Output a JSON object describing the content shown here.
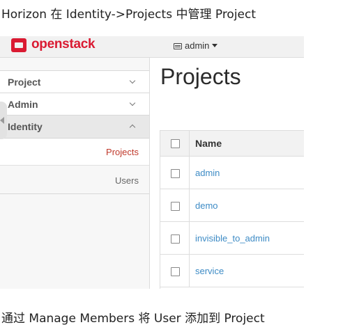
{
  "captions": {
    "top": "Horizon 在 Identity->Projects 中管理 Project",
    "bottom": "通过 Manage Members 将 User 添加到 Project"
  },
  "header": {
    "logo_text": "openstack",
    "project_switcher": "admin",
    "brand_color": "#da1a32"
  },
  "sidebar": {
    "sections": [
      {
        "label": "Project",
        "expanded": false
      },
      {
        "label": "Admin",
        "expanded": false
      },
      {
        "label": "Identity",
        "expanded": true
      }
    ],
    "identity_items": [
      {
        "label": "Projects",
        "active": true
      },
      {
        "label": "Users",
        "active": false
      }
    ]
  },
  "main": {
    "title": "Projects",
    "table": {
      "columns": [
        "Name"
      ],
      "rows": [
        {
          "name": "admin"
        },
        {
          "name": "demo"
        },
        {
          "name": "invisible_to_admin"
        },
        {
          "name": "service"
        }
      ]
    }
  }
}
